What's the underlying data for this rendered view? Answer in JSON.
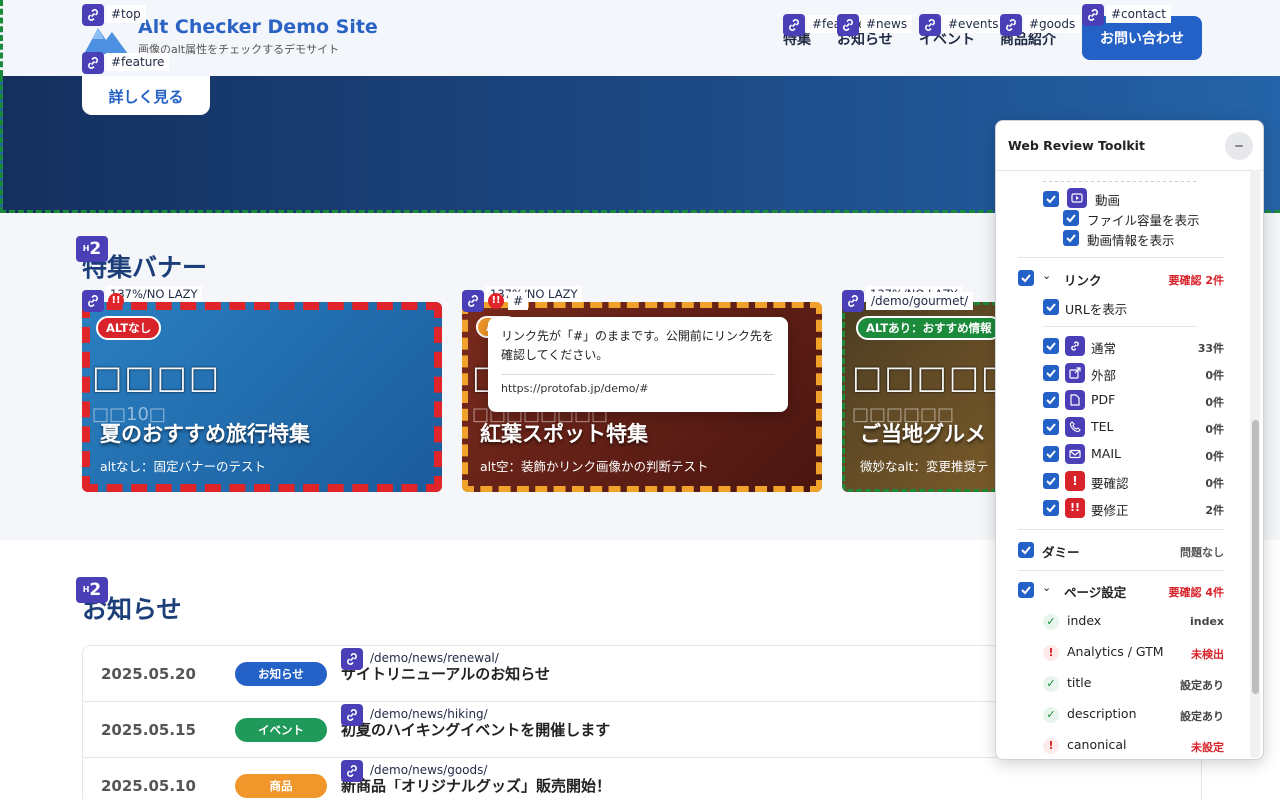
{
  "site": {
    "title": "Alt Checker Demo Site",
    "subtitle": "画像のalt属性をチェックするデモサイト",
    "nav": [
      "特集",
      "お知らせ",
      "イベント",
      "商品紹介"
    ],
    "contact": "お問い合わせ"
  },
  "hero": {
    "more_button": "詳しく見る"
  },
  "anchors": {
    "top": "#top",
    "feature": "#feature",
    "nav_feature": "#feature",
    "nav_news": "#news",
    "nav_events": "#events",
    "nav_goods": "#goods",
    "nav_contact": "#contact"
  },
  "sections": {
    "feature_title": "特集バナー",
    "news_title": "お知らせ",
    "h2_label": "H2"
  },
  "banners": [
    {
      "size_label": "137%/NO LAZY",
      "alt_tag": "ALTなし",
      "glyph": "□□□□",
      "glyph2": "□□10□",
      "title": "夏のおすすめ旅行特集",
      "desc": "altなし：固定バナーのテスト"
    },
    {
      "size_label": "137%/NO LAZY",
      "alt_tag": "ALT",
      "link": "#",
      "glyph": "□",
      "glyph2": "□□□□□□□□",
      "title": "紅葉スポット特集",
      "desc": "alt空：装飾かリンク画像かの判断テスト"
    },
    {
      "size_label": "137%/NO LAZY",
      "alt_tag": "ALTあり：おすすめ情報",
      "link": "/demo/gourmet/",
      "glyph": "□□□□□□□□",
      "glyph2": "□□□□□□",
      "title": "ご当地グルメ",
      "desc": "微妙なalt：変更推奨テ"
    }
  ],
  "tooltip": {
    "message": "リンク先が「#」のままです。公開前にリンク先を確認してください。",
    "url": "https://protofab.jp/demo/#"
  },
  "news": [
    {
      "date": "2025.05.20",
      "category": "お知らせ",
      "color": "#2461c7",
      "title": "サイトリニューアルのお知らせ",
      "link": "/demo/news/renewal/"
    },
    {
      "date": "2025.05.15",
      "category": "イベント",
      "color": "#1f9a5a",
      "title": "初夏のハイキングイベントを開催します",
      "link": "/demo/news/hiking/"
    },
    {
      "date": "2025.05.10",
      "category": "商品",
      "color": "#f0962a",
      "title": "新商品「オリジナルグッズ」販売開始！",
      "link": "/demo/news/goods/"
    }
  ],
  "panel": {
    "title": "Web Review Toolkit",
    "minimize": "−",
    "video": "動画",
    "video_size": "ファイル容量を表示",
    "video_info": "動画情報を表示",
    "link_section": "リンク",
    "link_status": "要確認 2件",
    "show_url": "URLを表示",
    "link_items": [
      {
        "label": "通常",
        "count": "33件",
        "icon": "link-icon"
      },
      {
        "label": "外部",
        "count": "0件",
        "icon": "external-icon"
      },
      {
        "label": "PDF",
        "count": "0件",
        "icon": "pdf-icon"
      },
      {
        "label": "TEL",
        "count": "0件",
        "icon": "phone-icon"
      },
      {
        "label": "MAIL",
        "count": "0件",
        "icon": "mail-icon"
      },
      {
        "label": "要確認",
        "count": "0件",
        "icon": "warning-icon"
      },
      {
        "label": "要修正",
        "count": "2件",
        "icon": "error-icon"
      }
    ],
    "dummy": "ダミー",
    "dummy_status": "問題なし",
    "page_section": "ページ設定",
    "page_status": "要確認 4件",
    "page_items": [
      {
        "label": "index",
        "value": "index",
        "ok": true
      },
      {
        "label": "Analytics / GTM",
        "value": "未検出",
        "ok": false
      },
      {
        "label": "title",
        "value": "設定あり",
        "ok": true
      },
      {
        "label": "description",
        "value": "設定あり",
        "ok": true
      },
      {
        "label": "canonical",
        "value": "未設定",
        "ok": false
      }
    ]
  },
  "colors": {
    "accent": "#2461c7",
    "badge": "#4b3fb8",
    "error": "#d9232a",
    "ok": "#1b8a3a"
  }
}
